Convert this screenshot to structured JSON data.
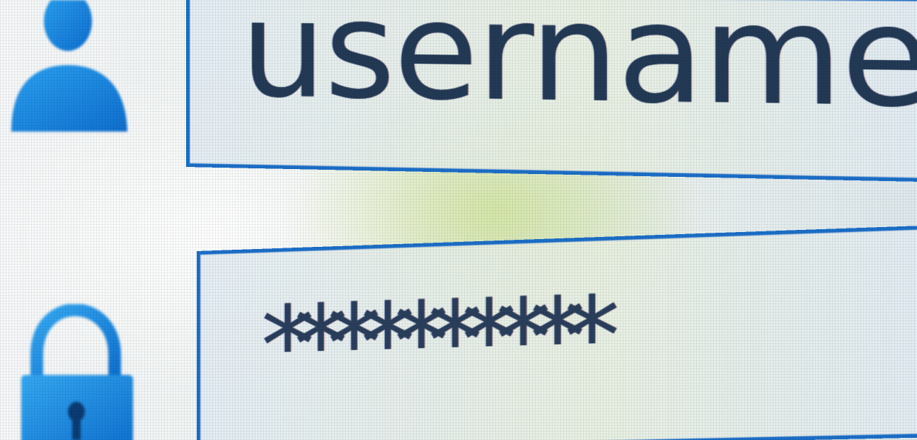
{
  "login": {
    "username": {
      "icon": "user-icon",
      "value": "username"
    },
    "password": {
      "icon": "lock-icon",
      "masked_value": "**********"
    }
  },
  "colors": {
    "accent": "#1c6fc9",
    "icon_blue": "#1a8ee6",
    "text": "#233a56"
  }
}
